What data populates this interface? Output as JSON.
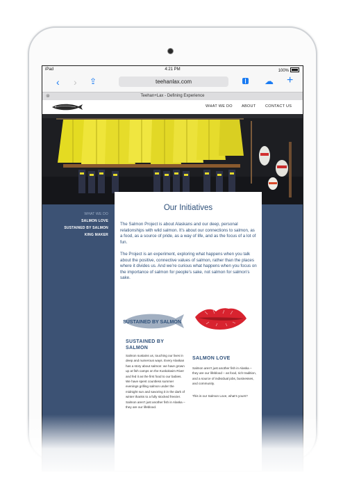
{
  "status_bar": {
    "carrier": "iPad",
    "time": "4:21 PM",
    "battery": "100%"
  },
  "browser": {
    "url": "teehanlax.com",
    "tab_title": "Teehan+Lax - Defining Experience"
  },
  "site_nav": {
    "items": [
      "WHAT WE DO",
      "ABOUT",
      "CONTACT US"
    ]
  },
  "side_menu": {
    "items": [
      "WHAT WE DO",
      "SALMON LOVE",
      "SUSTAINED BY SALMON",
      "KING MAKER"
    ]
  },
  "content": {
    "heading": "Our Initiatives",
    "paragraphs": [
      "The Salmon Project is about Alaskans and our deep, personal relationships with wild salmon. It’s about our connections to salmon, as a food, as a source of pride, as a way of life, and as the focus of a lot of fun.",
      "The Project is an experiment, exploring what happens when you talk about the positive, connective values of salmon, rather than the places where it divides us. And we’re curious what happens when you focus on the importance of salmon for people’s sake, not salmon for salmon’s sake."
    ],
    "columns": [
      {
        "logo_text": "SUSTAINED BY SALMON",
        "title": "SUSTAINED BY SALMON",
        "text": "Salmon sustains us, touching our lives in deep and numerous ways. Every Alaskan has a story about salmon: we have grown up at fish camps on the Kuskokwim River and fed it as the first food to our babies. We have spent countless summer evenings grilling salmon under the midnight sun and savoring it in the dark of winter thanks to a fully stocked freezer. Salmon aren’t just another fish in Alaska – they are our lifeblood."
      },
      {
        "title": "SALMON LOVE",
        "text": "Salmon aren’t just another fish in Alaska – they are our lifeblood – as food, rich tradition, and a source of individual jobs, businesses, and community.",
        "text2": "This is our Salmon Love, what’s yours?"
      }
    ]
  },
  "colors": {
    "accent": "#1a7bf2",
    "brand_blue": "#3c5274",
    "heading": "#2d4f79",
    "lips": "#d8232f",
    "jacket_yellow": "#e8df2c"
  }
}
